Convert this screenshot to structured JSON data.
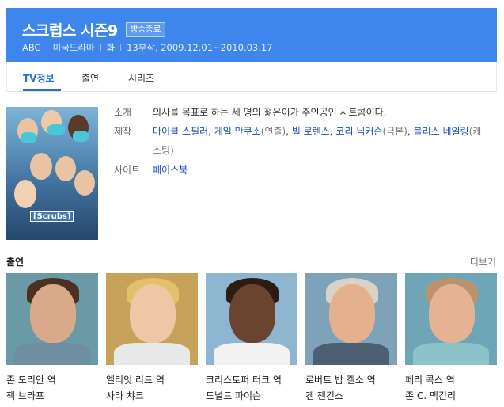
{
  "header": {
    "title": "스크럽스 시즌9",
    "badge": "방송종료",
    "meta": [
      "ABC",
      "미국드라마",
      "화",
      "13부작, 2009.12.01~2010.03.17"
    ]
  },
  "tabs": [
    {
      "label": "TV정보",
      "active": true
    },
    {
      "label": "출연",
      "active": false
    },
    {
      "label": "시리즈",
      "active": false
    }
  ],
  "info": {
    "summary_label": "소개",
    "summary": "의사를 목표로 하는 세 명의 젊은이가 주인공인 시트콤이다.",
    "production_label": "제작",
    "production": [
      {
        "name": "마이클 스필러",
        "role": ""
      },
      {
        "name": "게일 만쿠소",
        "role": "(연출)"
      },
      {
        "name": "빌 로렌스",
        "role": ""
      },
      {
        "name": "코리 닉커슨",
        "role": "(극본)"
      },
      {
        "name": "블리스 네일링",
        "role": "(캐스팅)"
      }
    ],
    "site_label": "사이트",
    "site": "페이스북"
  },
  "cast_section": {
    "title": "출연",
    "more": "더보기",
    "members": [
      {
        "role": "존 도리안 역",
        "actor": "잭 브라프",
        "bg": "#6a9aa6",
        "skin": "#d9a98a",
        "hair": "#4a3120",
        "shirt": "#6d8fa0"
      },
      {
        "role": "엘리엇 리드 역",
        "actor": "사라 챠크",
        "bg": "#c7a25a",
        "skin": "#f0c7a6",
        "hair": "#e3c06a",
        "shirt": "#e8e8e8"
      },
      {
        "role": "크리스토퍼 터크 역",
        "actor": "도널드 파이슨",
        "bg": "#8fb6d0",
        "skin": "#6b4430",
        "hair": "#2c1d14",
        "shirt": "#f2f2f2"
      },
      {
        "role": "로버트 밥 켈소 역",
        "actor": "켄 젠킨스",
        "bg": "#7ea3b8",
        "skin": "#e4b08e",
        "hair": "#d9d2c6",
        "shirt": "#4d5f72"
      },
      {
        "role": "페리 콕스 역",
        "actor": "존 C. 맥긴리",
        "bg": "#6fa6b7",
        "skin": "#e5b394",
        "hair": "#b9936c",
        "shirt": "#8cc3c9"
      }
    ]
  }
}
